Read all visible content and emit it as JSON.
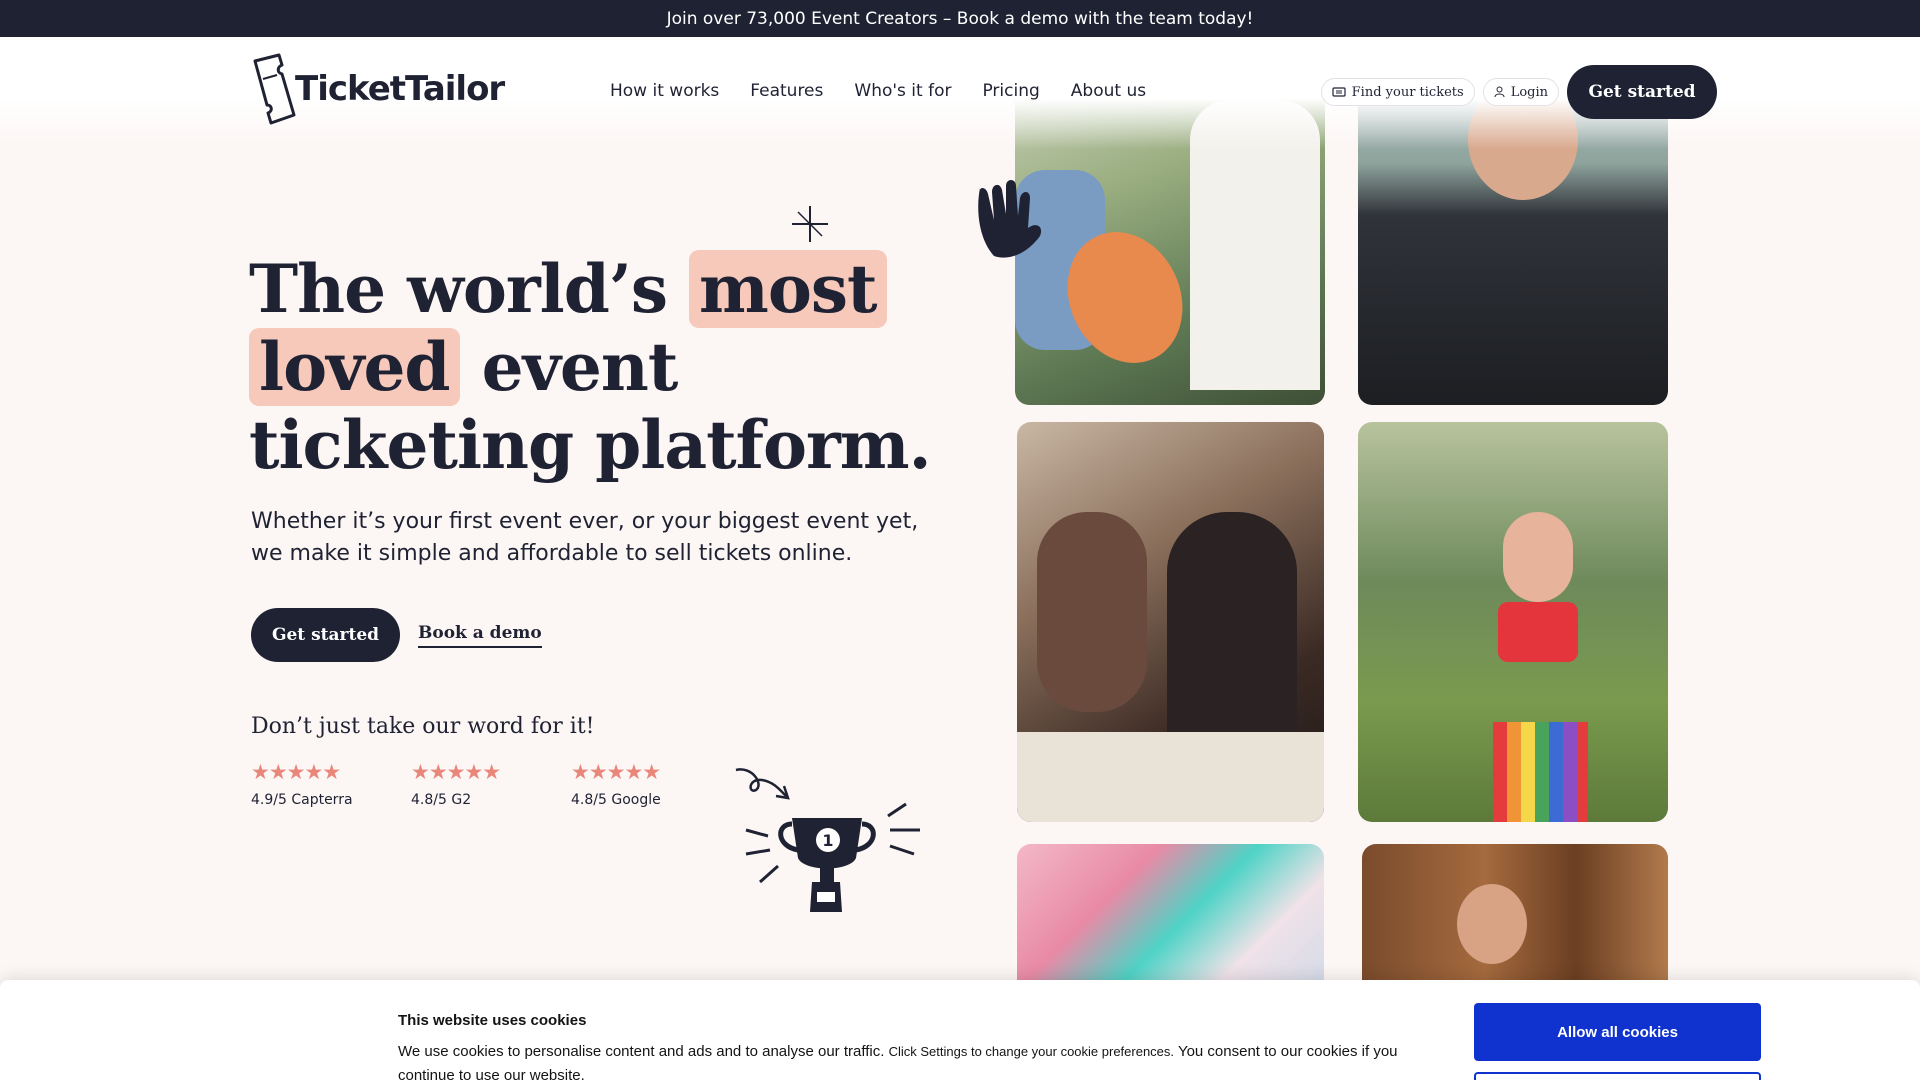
{
  "announcement": "Join over 73,000 Event Creators – Book a demo with the team today!",
  "header": {
    "logo_text": "TicketTailor",
    "nav": [
      "How it works",
      "Features",
      "Who's it for",
      "Pricing",
      "About us"
    ],
    "find_tickets": "Find your tickets",
    "login": "Login",
    "get_started": "Get started"
  },
  "hero": {
    "headline_part1": "The world’s",
    "headline_hl1": "most",
    "headline_hl2": "loved",
    "headline_part2": "event",
    "headline_part3": "ticketing platform.",
    "subtitle": "Whether it’s your first event ever, or your biggest event yet, we make it simple and affordable to sell tickets online.",
    "cta_primary": "Get started",
    "cta_secondary": "Book a demo",
    "proof_title": "Don’t just take our word for it!",
    "ratings": [
      {
        "stars": "★★★★★",
        "text": "4.9/5 Capterra"
      },
      {
        "stars": "★★★★★",
        "text": "4.8/5 G2"
      },
      {
        "stars": "★★★★★",
        "text": "4.8/5 Google"
      }
    ]
  },
  "icons": {
    "ticket": "ticket-icon",
    "user": "user-icon",
    "trophy": "trophy-icon",
    "hand": "hand-icon",
    "sparkle": "sparkle-icon",
    "arrow": "curly-arrow-icon"
  },
  "cookie": {
    "title": "This website uses cookies",
    "body_main": "We use cookies to personalise content and ads and to analyse our traffic.",
    "body_small": "Click Settings to change your cookie preferences.",
    "body_end": "You consent to our cookies if you continue to use our website.",
    "allow_all": "Allow all cookies"
  },
  "colors": {
    "dark": "#1f2233",
    "highlight": "#f7c9bb",
    "star": "#e8877a",
    "cookie_button": "#1032cf"
  }
}
